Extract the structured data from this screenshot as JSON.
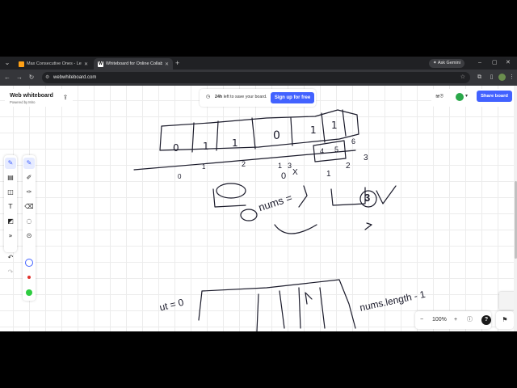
{
  "browser": {
    "tabs": [
      {
        "label": "Max Consecutive Ones - Leet...",
        "favicon_color": "#ffa116",
        "active": false
      },
      {
        "label": "Whiteboard for Online Collab...",
        "favicon_color": "#ffffff",
        "active": true
      }
    ],
    "new_tab": "+",
    "gemini_label": "Ask Gemini",
    "url": "webwhiteboard.com",
    "window_controls": [
      "–",
      "▢",
      "✕"
    ]
  },
  "whiteboard": {
    "brand_title": "Web whiteboard",
    "brand_subtitle": "Powered by Miro",
    "save_notice": {
      "bold": "24h",
      "text": " left to save your board."
    },
    "signup_label": "Sign up for free",
    "share_label": "Share board",
    "zoom_level": "100%",
    "zoom_out": "−",
    "zoom_in": "+",
    "help": "?",
    "colors": {
      "accent": "#4262ff",
      "red_dot": "#e0322d",
      "green_dot": "#2ecc40"
    }
  },
  "sketch": {
    "array_top_cells": [
      "0",
      "1",
      "1",
      "0",
      "1",
      "1"
    ],
    "index_labels": [
      "0",
      "1",
      "2",
      "3",
      "4",
      "5",
      "6"
    ],
    "index_labels_right": [
      "1",
      "2",
      "3"
    ],
    "count_label": "0",
    "x_mark": "X",
    "note": "nums =",
    "answer": "3",
    "bottom_left_note": "ut = 0",
    "bottom_right_note": "nums.length - 1"
  },
  "tools_primary": [
    "pen-icon",
    "sticky-note-icon",
    "sticky-icon",
    "text-icon",
    "shapes-icon",
    "more-icon",
    "undo-icon",
    "redo-icon"
  ],
  "tools_secondary": [
    "pen-icon",
    "marker-icon",
    "highlighter-icon",
    "eraser-icon",
    "lasso-icon",
    "color-ring",
    "red-dot",
    "green-dot"
  ]
}
